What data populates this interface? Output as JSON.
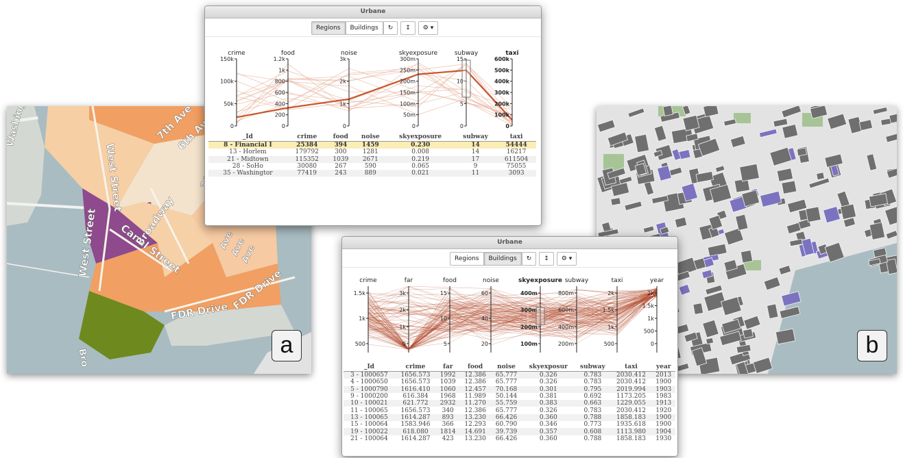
{
  "map_left": {
    "badge": "a",
    "streets": [
      "Washing",
      "West Street",
      "West Street",
      "Canal Street",
      "Broadway",
      "FDR Drive",
      "FDR Drive",
      "7th Ave",
      "6th Ave",
      "Bro",
      "Ave",
      "Ave",
      "Ave",
      "3r"
    ]
  },
  "map_right": {
    "badge": "b"
  },
  "window_regions": {
    "title": "Urbane",
    "toolbar": {
      "tab_regions": "Regions",
      "tab_buildings": "Buildings",
      "refresh_icon": "↻",
      "sort_icon": "↕",
      "settings_icon": "⚙ ▾"
    },
    "active_tab": "Regions",
    "axes": [
      {
        "label": "crime",
        "ticks": [
          "150k",
          "100k",
          "50k",
          "0"
        ],
        "bold": false
      },
      {
        "label": "food",
        "ticks": [
          "1.2k",
          "1k",
          "800",
          "600",
          "400",
          "200",
          "0"
        ],
        "bold": false
      },
      {
        "label": "noise",
        "ticks": [
          "3k",
          "2k",
          "1k",
          "0"
        ],
        "bold": false
      },
      {
        "label": "skyexposure",
        "ticks": [
          "300m",
          "250m",
          "200m",
          "150m",
          "100m",
          "50m",
          "0"
        ],
        "bold": false
      },
      {
        "label": "subway",
        "ticks": [
          "15",
          "10",
          "5",
          "0"
        ],
        "bold": false
      },
      {
        "label": "taxi",
        "ticks": [
          "600k",
          "500k",
          "400k",
          "300k",
          "200k",
          "100k",
          "0"
        ],
        "bold": true
      }
    ],
    "table": {
      "headers": [
        "_Id",
        "crime",
        "food",
        "noise",
        "skyexposure",
        "subway",
        "taxi"
      ],
      "rows": [
        [
          "8 - Financial I",
          "25384",
          "394",
          "1459",
          "0.230",
          "14",
          "54444"
        ],
        [
          "13 - Horlem",
          "179792",
          "300",
          "1281",
          "0.008",
          "14",
          "16217"
        ],
        [
          "21 - Midtown",
          "115352",
          "1039",
          "2671",
          "0.219",
          "17",
          "611504"
        ],
        [
          "28 - SoHo",
          "30080",
          "267",
          "590",
          "0.065",
          "9",
          "75055"
        ],
        [
          "35 - Washingtor",
          "77419",
          "243",
          "889",
          "0.021",
          "11",
          "3093"
        ]
      ],
      "highlight_row": 0
    }
  },
  "window_buildings": {
    "title": "Urbane",
    "toolbar": {
      "tab_regions": "Regions",
      "tab_buildings": "Buildings",
      "refresh_icon": "↻",
      "sort_icon": "↕",
      "settings_icon": "⚙ ▾"
    },
    "active_tab": "Buildings",
    "axes": [
      {
        "label": "crime",
        "ticks": [
          "1.5k",
          "1k",
          "500"
        ],
        "bold": false
      },
      {
        "label": "far",
        "ticks": [
          "3k",
          "2k",
          "1k",
          "0"
        ],
        "bold": false
      },
      {
        "label": "food",
        "ticks": [
          "15",
          "10",
          "5"
        ],
        "bold": false
      },
      {
        "label": "noise",
        "ticks": [
          "60",
          "40",
          "20"
        ],
        "bold": false
      },
      {
        "label": "skyexposure",
        "ticks": [
          "400m",
          "300m",
          "200m",
          "100m"
        ],
        "bold": true
      },
      {
        "label": "subway",
        "ticks": [
          "800m",
          "600m",
          "400m",
          "200m"
        ],
        "bold": false
      },
      {
        "label": "taxi",
        "ticks": [
          "2k",
          "1.5k",
          "1k",
          "500"
        ],
        "bold": false
      },
      {
        "label": "year",
        "ticks": [
          "2k",
          "1.5k",
          "1k",
          "500",
          "0"
        ],
        "bold": false
      }
    ],
    "table": {
      "headers": [
        "_Id",
        "crime",
        "far",
        "food",
        "noise",
        "skyexposur",
        "subway",
        "taxi",
        "year"
      ],
      "rows": [
        [
          "3 - 1000657",
          "1656.573",
          "1992",
          "12.386",
          "65.777",
          "0.326",
          "0.783",
          "2030.412",
          "2013"
        ],
        [
          "4 - 1000650",
          "1656.573",
          "1039",
          "12.386",
          "65.777",
          "0.326",
          "0.783",
          "2030.412",
          "1900"
        ],
        [
          "5 - 1000790",
          "1616.410",
          "1060",
          "12.457",
          "70.168",
          "0.301",
          "0.795",
          "2019.994",
          "1903"
        ],
        [
          "9 - 1000200",
          "616.384",
          "1968",
          "11.989",
          "50.144",
          "0.381",
          "0.692",
          "1173.205",
          "1983"
        ],
        [
          "10 - 100021",
          "621.772",
          "2932",
          "11.270",
          "55.759",
          "0.383",
          "0.663",
          "1229.055",
          "1913"
        ],
        [
          "11 - 100065",
          "1656.573",
          "340",
          "12.386",
          "65.777",
          "0.326",
          "0.783",
          "2030.412",
          "1920"
        ],
        [
          "13 - 100065",
          "1614.287",
          "893",
          "13.230",
          "66.426",
          "0.360",
          "0.788",
          "1858.183",
          "1900"
        ],
        [
          "15 - 100064",
          "1583.946",
          "366",
          "12.293",
          "60.790",
          "0.346",
          "0.773",
          "1935.618",
          "1900"
        ],
        [
          "19 - 100022",
          "618.080",
          "1814",
          "14.691",
          "39.739",
          "0.357",
          "0.608",
          "1113.980",
          "1904"
        ],
        [
          "21 - 100064",
          "1614.287",
          "423",
          "13.230",
          "66.426",
          "0.360",
          "0.788",
          "1858.183",
          "1930"
        ]
      ]
    }
  },
  "colors": {
    "line_accent": "#c8552d",
    "line_faint": "#e9b8a4",
    "map_water": "#a9bcc2",
    "map_purple": "#8e4a8c",
    "map_green": "#6e8a1f",
    "map_orange": "#f0955a",
    "building_blue": "#7c73c0",
    "building_gray": "#6f6f6f"
  }
}
